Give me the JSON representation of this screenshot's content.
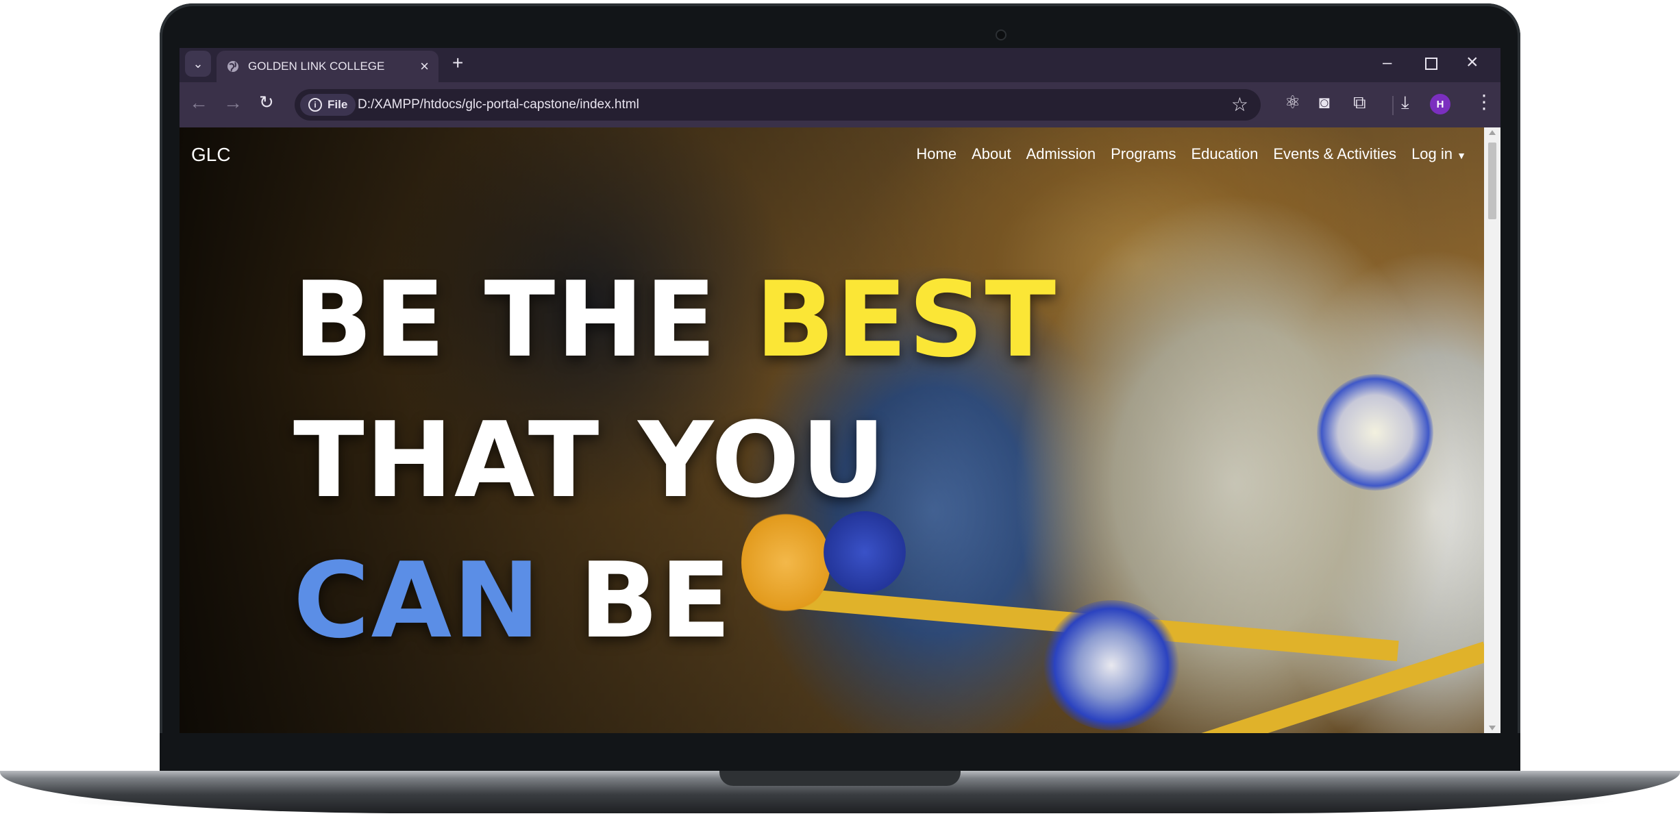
{
  "browser": {
    "tab": {
      "title": "GOLDEN LINK COLLEGE",
      "icon": "globe-icon"
    },
    "address": {
      "chip_label": "File",
      "url": "D:/XAMPP/htdocs/glc-portal-capstone/index.html"
    },
    "profile_initial": "H"
  },
  "site": {
    "brand": "GLC",
    "nav": [
      "Home",
      "About",
      "Admission",
      "Programs",
      "Education",
      "Events & Activities",
      "Log in"
    ],
    "hero": {
      "line1a": "BE THE",
      "line1b": "BEST",
      "line2": "THAT YOU",
      "line3a": "CAN",
      "line3b": "BE"
    }
  },
  "colors": {
    "accent_yellow": "#fbe636",
    "accent_blue": "#5b8ee6"
  }
}
